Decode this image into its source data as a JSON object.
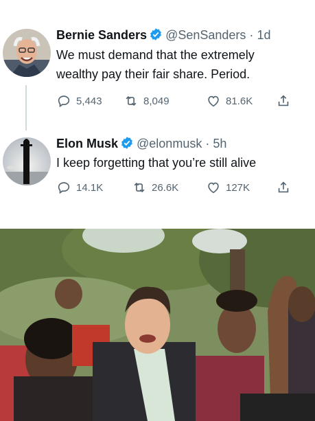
{
  "tweets": [
    {
      "name": "Bernie Sanders",
      "handle": "@SenSanders",
      "separator": "·",
      "time": "1d",
      "text_line1": "We must demand that the extremely",
      "text_line2": "wealthy pay their fair share. Period.",
      "replies": "5,443",
      "retweets": "8,049",
      "likes": "81.6K",
      "avatar_icon": "portrait-avatar-icon"
    },
    {
      "name": "Elon Musk",
      "handle": "@elonmusk",
      "separator": "·",
      "time": "5h",
      "text_line1": "I keep forgetting that you’re still alive",
      "replies": "14.1K",
      "retweets": "26.6K",
      "likes": "127K",
      "avatar_icon": "rocket-avatar-icon"
    }
  ],
  "icons": {
    "verified": "verified-badge-icon",
    "reply": "reply-icon",
    "retweet": "retweet-icon",
    "like": "heart-icon",
    "share": "share-icon"
  },
  "colors": {
    "verified_blue": "#1d9bf0",
    "secondary_text": "#536471",
    "primary_text": "#0f1419"
  }
}
